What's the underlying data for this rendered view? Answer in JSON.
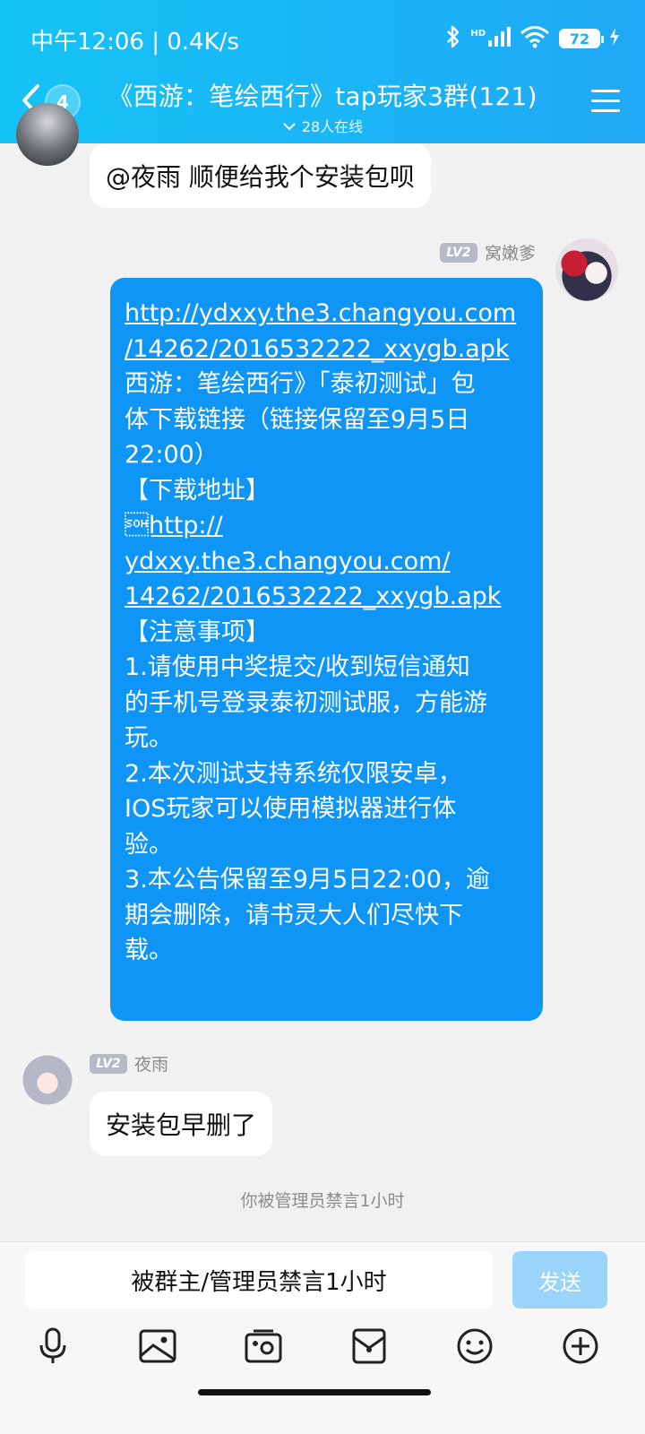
{
  "status_bar": {
    "time_speed": "中午12:06 | 0.4K/s",
    "hd_label": "HD",
    "battery": "72"
  },
  "header": {
    "unread_count": "4",
    "title": "《西游：笔绘西行》tap玩家3群(121)",
    "online_text": "28人在线"
  },
  "messages": {
    "m1": {
      "text": "@夜雨 顺便给我个安装包呗"
    },
    "m2": {
      "level": "LV2",
      "sender": "窝嫩爹",
      "lines": [
        "http://ydxxy.the3.changyou.com",
        "/14262/2016532222_xxygb.apk",
        "西游：笔绘西行》「泰初测试」包",
        "体下载链接（链接保留至9月5日",
        "22:00）",
        "【下载地址】",
        "\u0001http://",
        "ydxxy.the3.changyou.com/",
        "14262/2016532222_xxygb.apk",
        "【注意事项】",
        "1.请使用中奖提交/收到短信通知",
        "的手机号登录泰初测试服，方能游",
        "玩。",
        "2.本次测试支持系统仅限安卓，",
        "IOS玩家可以使用模拟器进行体",
        "验。",
        "3.本公告保留至9月5日22:00，逾",
        "期会删除，请书灵大人们尽快下",
        "载。"
      ]
    },
    "m3": {
      "level": "LV2",
      "sender": "夜雨",
      "text": "安装包早删了"
    }
  },
  "system_notice": "你被管理员禁言1小时",
  "input": {
    "placeholder": "被群主/管理员禁言1小时",
    "send_label": "发送"
  },
  "toolbar_icons": [
    "microphone-icon",
    "image-icon",
    "camera-icon",
    "red-packet-icon",
    "emoji-icon",
    "plus-icon"
  ],
  "colors": {
    "header": "#14c3f5",
    "bubble_blue": "#0f95f6",
    "send_disabled": "#9bd4fb"
  }
}
